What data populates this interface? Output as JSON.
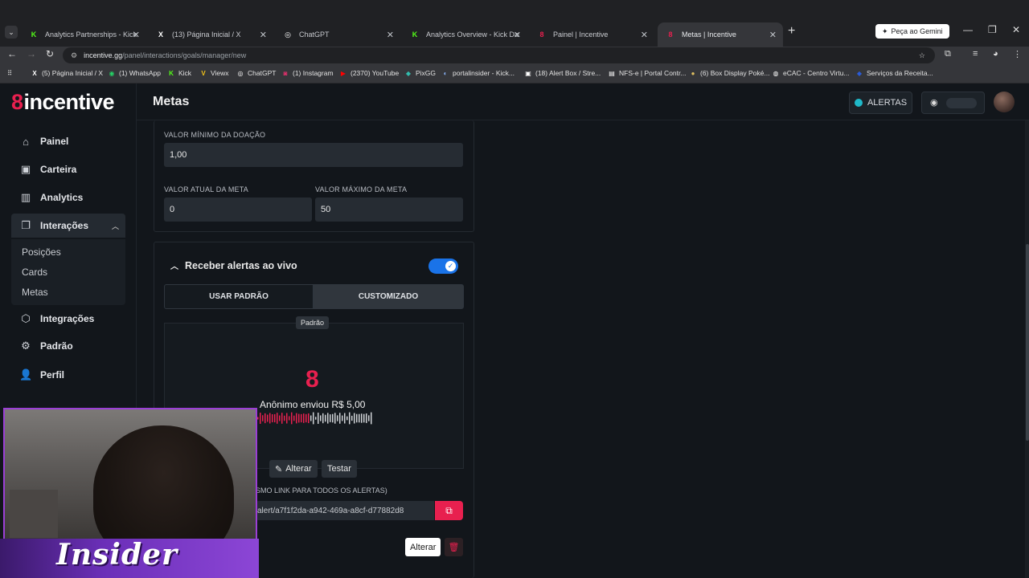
{
  "browser": {
    "tabs": [
      {
        "title": "Analytics Partnerships - Kick Da",
        "favicon": "K",
        "color": "#53fc18"
      },
      {
        "title": "(13) Página Inicial / X",
        "favicon": "X",
        "color": "#ffffff"
      },
      {
        "title": "ChatGPT",
        "favicon": "◎",
        "color": "#ffffff"
      },
      {
        "title": "Analytics Overview - Kick Dashb",
        "favicon": "K",
        "color": "#53fc18"
      },
      {
        "title": "Painel | Incentive",
        "favicon": "8",
        "color": "#e8204f"
      },
      {
        "title": "Metas | Incentive",
        "favicon": "8",
        "color": "#e8204f"
      }
    ],
    "new_tab": "+",
    "gemini_label": "Peça ao Gemini",
    "url_host": "incentive.gg",
    "url_path": "/panel/interactions/goals/manager/new",
    "bookmarks": [
      {
        "label": "(5) Página Inicial / X",
        "icon": "X",
        "color": "#ffffff"
      },
      {
        "label": "(1) WhatsApp",
        "icon": "◉",
        "color": "#25d366"
      },
      {
        "label": "Kick",
        "icon": "K",
        "color": "#53fc18"
      },
      {
        "label": "Viewx",
        "icon": "V",
        "color": "#f5c518"
      },
      {
        "label": "ChatGPT",
        "icon": "◎",
        "color": "#ffffff"
      },
      {
        "label": "(1) Instagram",
        "icon": "◙",
        "color": "#e1306c"
      },
      {
        "label": "(2370) YouTube",
        "icon": "▶",
        "color": "#ff0000"
      },
      {
        "label": "PixGG",
        "icon": "◆",
        "color": "#32bcad"
      },
      {
        "label": "portalinsider - Kick...",
        "icon": "◐",
        "color": "#8ab4f8"
      },
      {
        "label": "(18) Alert Box / Stre...",
        "icon": "▣",
        "color": "#ffffff"
      },
      {
        "label": "NFS-e | Portal Contr...",
        "icon": "▤",
        "color": "#ffffff"
      },
      {
        "label": "(6) Box Display Poké...",
        "icon": "●",
        "color": "#e0c060"
      },
      {
        "label": "eCAC - Centro Virtu...",
        "icon": "◍",
        "color": "#ffffff"
      },
      {
        "label": "Serviços da Receita...",
        "icon": "◆",
        "color": "#2a5bd7"
      }
    ]
  },
  "app": {
    "logo_text": "incentive",
    "page_title": "Metas",
    "nav": [
      {
        "label": "Painel",
        "icon": "⌂"
      },
      {
        "label": "Carteira",
        "icon": "▣"
      },
      {
        "label": "Analytics",
        "icon": "▥"
      },
      {
        "label": "Interações",
        "icon": "❐"
      },
      {
        "label": "Integrações",
        "icon": "⬡"
      },
      {
        "label": "Padrão",
        "icon": "⚙"
      },
      {
        "label": "Perfil",
        "icon": "👤"
      }
    ],
    "subnav": [
      "Posições",
      "Cards",
      "Metas"
    ],
    "alertas_label": "ALERTAS",
    "accent": "#e8204f"
  },
  "form": {
    "min_donation_label": "VALOR MÍNIMO DA DOAÇÃO",
    "min_donation_value": "1,00",
    "current_goal_label": "VALOR ATUAL DA META",
    "current_goal_value": "0",
    "max_goal_label": "VALOR MÁXIMO DA META",
    "max_goal_value": "50",
    "live_alerts_label": "Receber alertas ao vivo",
    "live_alerts_on": true,
    "segment_default": "USAR PADRÃO",
    "segment_custom": "CUSTOMIZADO",
    "preview_tag": "Padrão",
    "preview_text": "Anônimo enviou R$ 5,00",
    "alterar_label": "Alterar",
    "testar_label": "Testar",
    "link_label": "SMO LINK PARA TODOS OS ALERTAS)",
    "link_value": "alert/a7f1f2da-a942-469a-a8cf-d77882d8",
    "save_label": "Alterar"
  },
  "webcam": {
    "brand_text": "Insider"
  }
}
